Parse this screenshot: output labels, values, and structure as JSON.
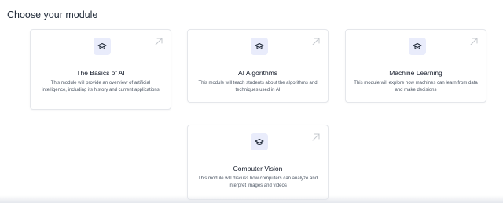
{
  "page": {
    "heading": "Choose your module"
  },
  "colors": {
    "icon_tile_bg": "#e9ecfb",
    "card_border": "#e5e7eb",
    "arrow": "#c4c8ce"
  },
  "modules": [
    {
      "title": "The Basics of AI",
      "description": "This module will provide an overview of artificial intelligence, including its history and current applications",
      "icon": "graduation-cap-icon",
      "action_icon": "arrow-up-right-icon"
    },
    {
      "title": "AI Algorithms",
      "description": "This module will teach students about the algorithms and techniques used in AI",
      "icon": "graduation-cap-icon",
      "action_icon": "arrow-up-right-icon"
    },
    {
      "title": "Machine Learning",
      "description": "This module will explore how machines can learn from data and make decisions",
      "icon": "graduation-cap-icon",
      "action_icon": "arrow-up-right-icon"
    },
    {
      "title": "Computer Vision",
      "description": "This module will discuss how computers can analyze and interpret images and videos",
      "icon": "graduation-cap-icon",
      "action_icon": "arrow-up-right-icon"
    }
  ]
}
